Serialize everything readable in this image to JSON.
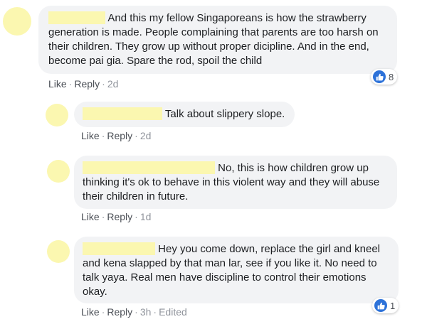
{
  "comments": [
    {
      "text": "And this my fellow Singaporeans is how the strawberry generation is made. People complaining that parents are too harsh on their children. They grow up without proper dicipline. And in the end, become pai gia. Spare the rod, spoil the child",
      "like_label": "Like",
      "reply_label": "Reply",
      "time": "2d",
      "reactions": "8"
    },
    {
      "text": "Talk about slippery slope.",
      "like_label": "Like",
      "reply_label": "Reply",
      "time": "2d"
    },
    {
      "text": "No, this is how children grow up thinking it's ok to behave in this violent way and they will abuse their children in future.",
      "like_label": "Like",
      "reply_label": "Reply",
      "time": "1d"
    },
    {
      "text": "Hey you come down, replace the girl and kneel and kena slapped by that man lar, see if you like it. No need to talk yaya. Real men have discipline to control their emotions okay.",
      "like_label": "Like",
      "reply_label": "Reply",
      "time": "3h",
      "edited": "Edited",
      "reactions": "1"
    }
  ],
  "icons": {
    "reaction": "thumbs-up-icon"
  },
  "colors": {
    "bubble": "#f2f3f5",
    "redaction": "#fbf7b0",
    "like_blue": "#2d72d9"
  }
}
